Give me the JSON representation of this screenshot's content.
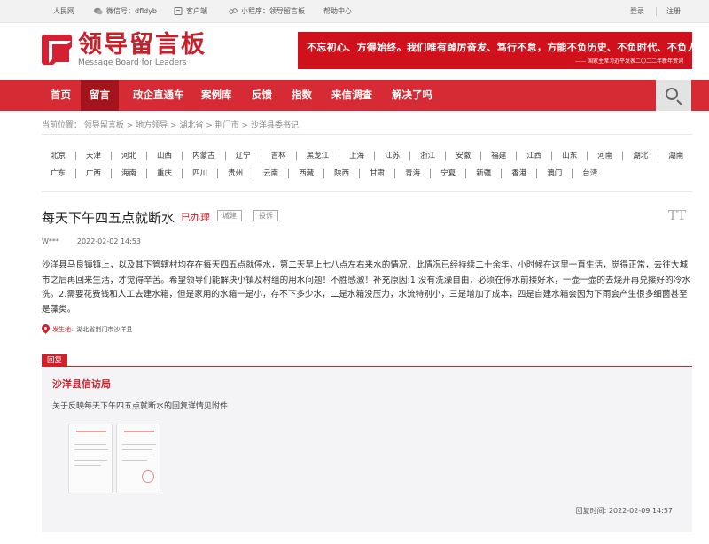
{
  "topbar": {
    "site": "人民网",
    "wechat": "微信号：dfldyb",
    "client": "客户端",
    "miniapp": "小程序：领导留言板",
    "help": "帮助中心",
    "login": "登录",
    "register": "注册"
  },
  "logo": {
    "cn": "领导留言板",
    "en": "Message Board for Leaders"
  },
  "banner": {
    "slogan": "不忘初心、方得始终。我们唯有踔厉奋发、笃行不怠，方能不负历史、不负时代、不负人民。",
    "source": "—— 国家主席习近平发表二〇二二年新年贺词"
  },
  "nav": {
    "items": [
      {
        "label": "首页"
      },
      {
        "label": "留言"
      },
      {
        "label": "政企直通车"
      },
      {
        "label": "案例库"
      },
      {
        "label": "反馈"
      },
      {
        "label": "指数"
      },
      {
        "label": "来信调查"
      },
      {
        "label": "解决了吗"
      }
    ],
    "active": "留言"
  },
  "breadcrumb": "当前位置： 领导留言板 > 地方领导 > 湖北省 > 荆门市 > 沙洋县委书记",
  "regions": {
    "row1": [
      "北京",
      "天津",
      "河北",
      "山西",
      "内蒙古",
      "辽宁",
      "吉林",
      "黑龙江",
      "上海",
      "江苏",
      "浙江",
      "安徽",
      "福建",
      "江西",
      "山东",
      "河南",
      "湖北",
      "湖南"
    ],
    "row2": [
      "广东",
      "广西",
      "海南",
      "重庆",
      "四川",
      "贵州",
      "云南",
      "西藏",
      "陕西",
      "甘肃",
      "青海",
      "宁夏",
      "新疆",
      "香港",
      "澳门",
      "台湾"
    ]
  },
  "message": {
    "title": "每天下午四五点就断水",
    "status": "已办理",
    "tag1": "城建",
    "tag2": "投诉",
    "font_icon": "TT",
    "user": "W***",
    "time": "2022-02-02 14:53",
    "content": "沙洋县马良镇镇上，以及其下管辖村均存在每天四五点就停水，第二天早上七八点左右来水的情况，此情况已经持续二十余年。小时候在这里一直生活，觉得正常，去往大城市之后再回来生活，才觉得辛苦。希望领导们能解决小镇及村组的用水问题！不胜感激！补充原因:1.没有洗澡自由，必须在停水前接好水，一壶一壶的去烧开再兑接好的冷水洗。2.需要花费钱和人工去建水箱，但是家用的水箱一是小，存不下多少水，二是水箱没压力，水流特别小，三是增加了成本，四是自建水箱会因为下雨会产生很多细菌甚至是藻类。",
    "place_label": "发生地:",
    "place": "湖北省荆门市沙洋县"
  },
  "reply": {
    "tab": "回复",
    "org": "沙洋县信访局",
    "text": "关于反映每天下午四五点就断水的回复详情见附件",
    "time_label": "回复时间:",
    "time": "2022-02-09 14:57"
  }
}
